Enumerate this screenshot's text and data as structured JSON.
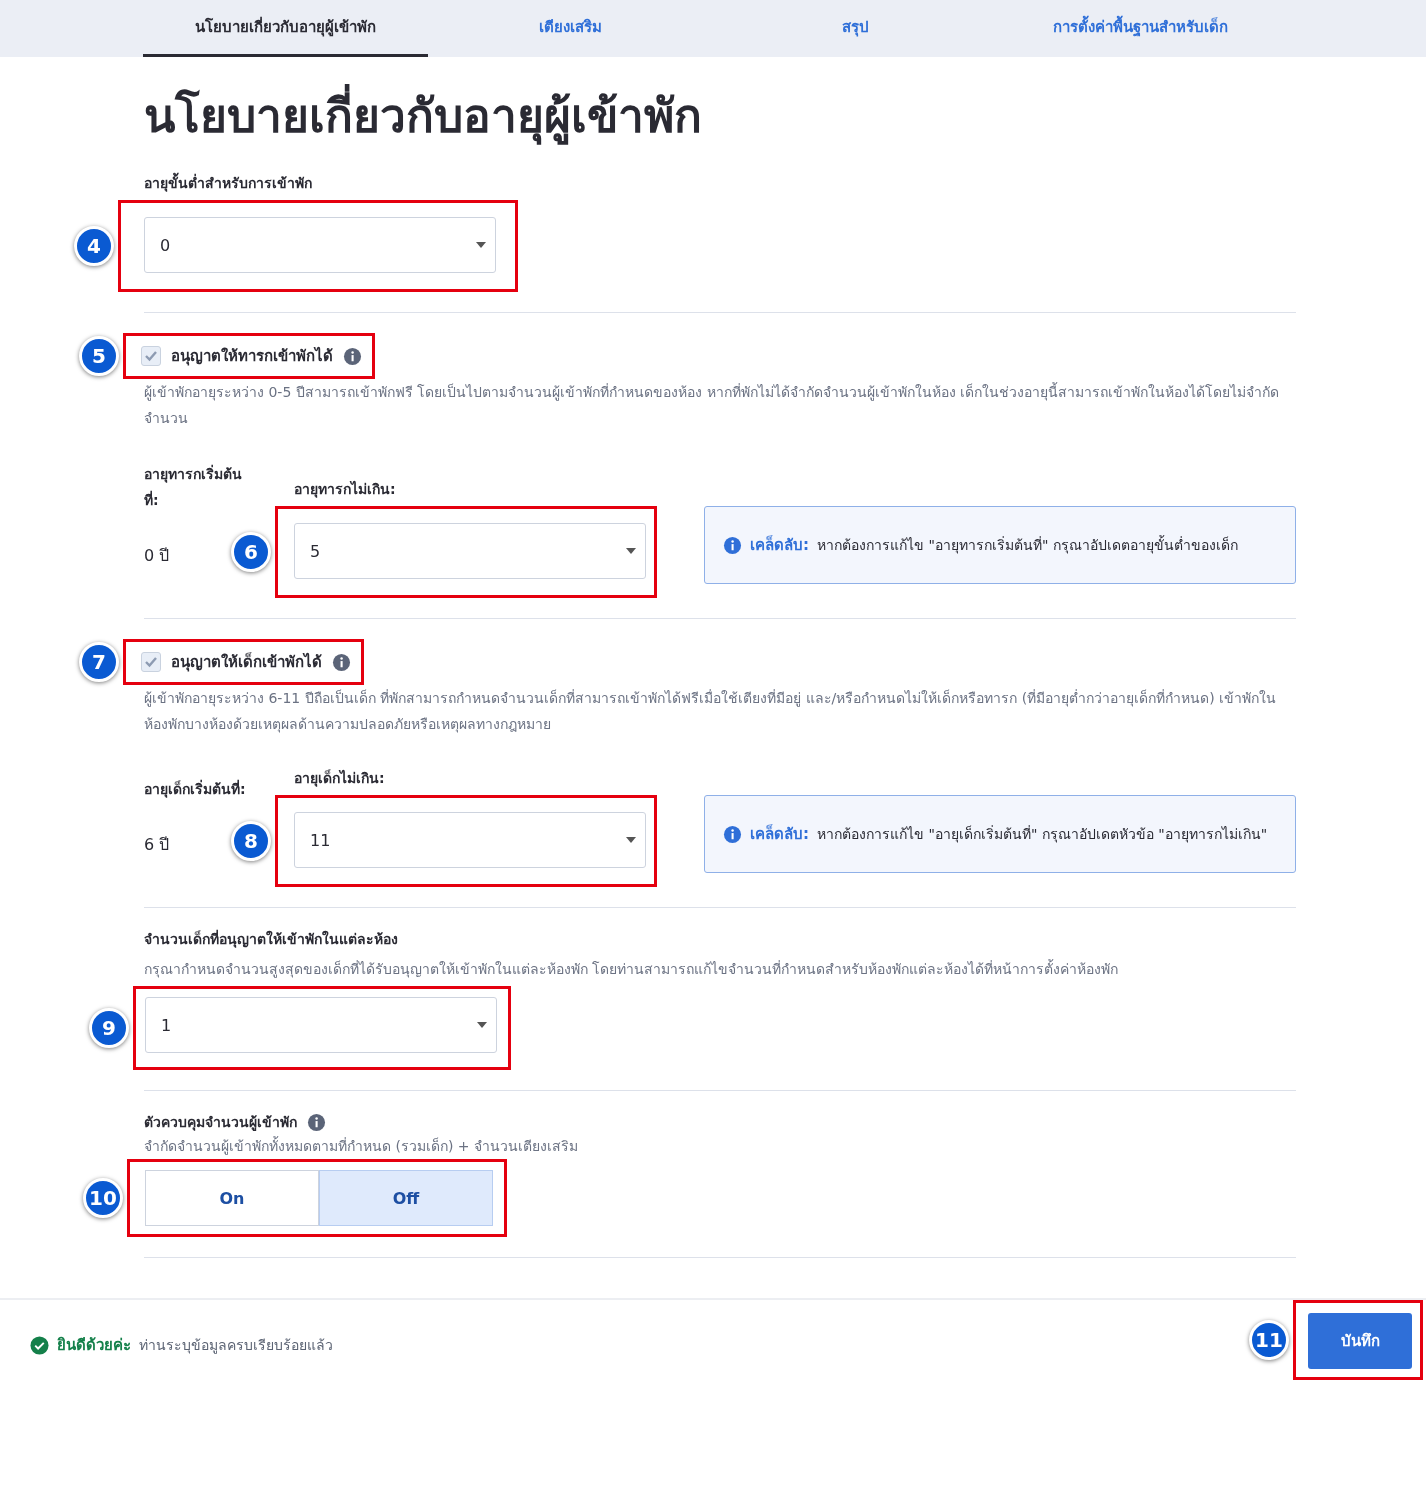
{
  "tabs": [
    {
      "label": "นโยบายเกี่ยวกับอายุผู้เข้าพัก",
      "selected": true
    },
    {
      "label": "เตียงเสริม",
      "selected": false
    },
    {
      "label": "สรุป",
      "selected": false
    },
    {
      "label": "การตั้งค่าพื้นฐานสำหรับเด็ก",
      "selected": false
    }
  ],
  "title": "นโยบายเกี่ยวกับอายุผู้เข้าพัก",
  "min_age": {
    "label": "อายุขั้นต่ำสำหรับการเข้าพัก",
    "value": "0",
    "callout": "4"
  },
  "age_groups": [
    {
      "checkbox": {
        "label": "อนุญาตให้ทารกเข้าพักได้",
        "checked": true,
        "disabled": true,
        "callout": "5"
      },
      "description": "ผู้เข้าพักอายุระหว่าง 0-5 ปีสามารถเข้าพักฟรี โดยเป็นไปตามจำนวนผู้เข้าพักที่กำหนดของห้อง หากที่พักไม่ได้จำกัดจำนวนผู้เข้าพักในห้อง เด็กในช่วงอายุนี้สามารถเข้าพักในห้องได้โดยไม่จำกัดจำนวน",
      "start_label": "อายุทารกเริ่มต้นที่:",
      "start_value": "0 ปี",
      "max_label": "อายุทารกไม่เกิน:",
      "max_value": "5",
      "max_callout": "6",
      "tip": {
        "label": "เคล็ดลับ:",
        "text": "หากต้องการแก้ไข \"อายุทารกเริ่มต้นที่\" กรุณาอัปเดตอายุขั้นต่ำของเด็ก"
      }
    },
    {
      "checkbox": {
        "label": "อนุญาตให้เด็กเข้าพักได้",
        "checked": true,
        "disabled": true,
        "callout": "7"
      },
      "description": "ผู้เข้าพักอายุระหว่าง 6-11 ปีถือเป็นเด็ก ที่พักสามารถกำหนดจำนวนเด็กที่สามารถเข้าพักได้ฟรีเมื่อใช้เตียงที่มีอยู่ และ/หรือกำหนดไม่ให้เด็กหรือทารก (ที่มีอายุต่ำกว่าอายุเด็กที่กำหนด) เข้าพักในห้องพักบางห้องด้วยเหตุผลด้านความปลอดภัยหรือเหตุผลทางกฎหมาย",
      "start_label": "อายุเด็กเริ่มต้นที่:",
      "start_value": "6 ปี",
      "max_label": "อายุเด็กไม่เกิน:",
      "max_value": "11",
      "max_callout": "8",
      "tip": {
        "label": "เคล็ดลับ:",
        "text": "หากต้องการแก้ไข \"อายุเด็กเริ่มต้นที่\" กรุณาอัปเดตหัวข้อ \"อายุทารกไม่เกิน\""
      }
    }
  ],
  "children_per_room": {
    "label": "จำนวนเด็กที่อนุญาตให้เข้าพักในแต่ละห้อง",
    "description": "กรุณากำหนดจำนวนสูงสุดของเด็กที่ได้รับอนุญาตให้เข้าพักในแต่ละห้องพัก โดยท่านสามารถแก้ไขจำนวนที่กำหนดสำหรับห้องพักแต่ละห้องได้ที่หน้าการตั้งค่าห้องพัก",
    "value": "1",
    "callout": "9"
  },
  "occupancy_control": {
    "label": "ตัวควบคุมจำนวนผู้เข้าพัก",
    "description": "จำกัดจำนวนผู้เข้าพักทั้งหมดตามที่กำหนด (รวมเด็ก) + จำนวนเตียงเสริม",
    "callout": "10",
    "options": [
      {
        "label": "On",
        "selected": false
      },
      {
        "label": "Off",
        "selected": true
      }
    ]
  },
  "footer": {
    "status_title": "ยินดีด้วยค่ะ",
    "status_text": "ท่านระบุข้อมูลครบเรียบร้อยแล้ว",
    "save_button": "บันทึก",
    "callout": "11"
  }
}
